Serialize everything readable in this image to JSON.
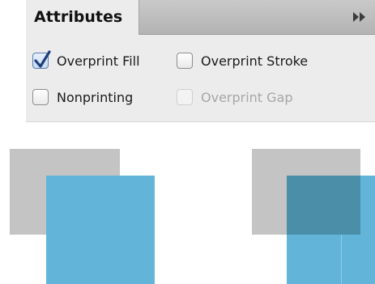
{
  "panel": {
    "tab_label": "Attributes",
    "flyout_icon": "double-chevron-right-icon",
    "options": {
      "overprint_fill": {
        "label": "Overprint Fill",
        "checked": true,
        "disabled": false
      },
      "overprint_stroke": {
        "label": "Overprint Stroke",
        "checked": false,
        "disabled": false
      },
      "nonprinting": {
        "label": "Nonprinting",
        "checked": false,
        "disabled": false
      },
      "overprint_gap": {
        "label": "Overprint Gap",
        "checked": false,
        "disabled": true
      }
    }
  },
  "colors": {
    "gray_square": "#c4c4c4",
    "blue_square": "#62b5d8",
    "overprint_overlap": "#4a8ea7"
  }
}
